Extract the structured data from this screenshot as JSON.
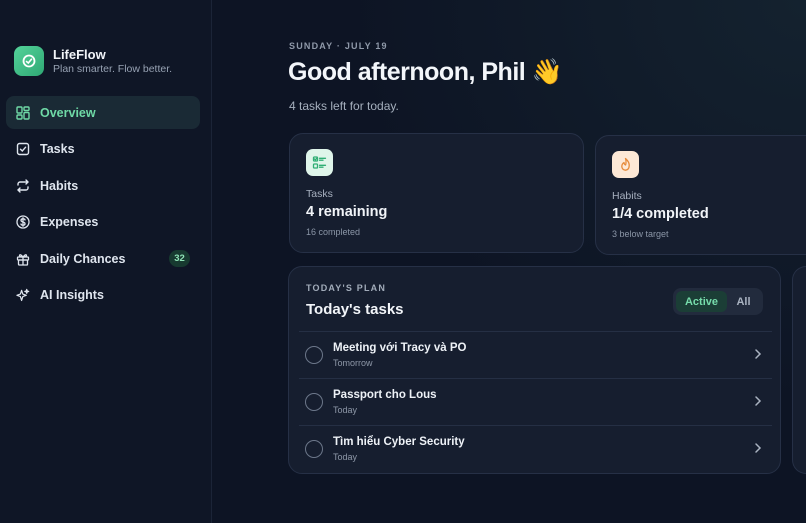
{
  "sidebar": {
    "brand": {
      "name": "LifeFlow",
      "tagline": "Plan smarter. Flow better."
    },
    "items": [
      {
        "label": "Overview",
        "icon": "grid-icon",
        "active": true
      },
      {
        "label": "Tasks",
        "icon": "checkbox-icon"
      },
      {
        "label": "Habits",
        "icon": "repeat-icon"
      },
      {
        "label": "Expenses",
        "icon": "dollar-icon"
      },
      {
        "label": "Daily Chances",
        "icon": "gift-icon",
        "badge": "32"
      },
      {
        "label": "AI Insights",
        "icon": "sparkles-icon"
      }
    ]
  },
  "header": {
    "date": "SUNDAY · JULY 19",
    "greeting": "Good afternoon, Phil 👋",
    "subtitle": "4 tasks left for today."
  },
  "stats": [
    {
      "label": "Tasks",
      "value": "4 remaining",
      "sub": "16 completed",
      "icon": "list-check-icon",
      "icon_bg": "#dff5ea"
    },
    {
      "label": "Habits",
      "value": "1/4 completed",
      "sub": "3 below target",
      "icon": "flame-icon",
      "icon_bg": "#fde8d6"
    }
  ],
  "plan": {
    "eyebrow": "TODAY'S PLAN",
    "title": "Today's tasks",
    "filters": {
      "active": "Active",
      "all": "All"
    },
    "tasks": [
      {
        "title": "Meeting với Tracy và PO",
        "due": "Tomorrow"
      },
      {
        "title": "Passport cho Lous",
        "due": "Today"
      },
      {
        "title": "Tìm hiểu Cyber Security",
        "due": "Today"
      }
    ]
  },
  "colors": {
    "accent": "#6fd9a6",
    "background": "#0d1424",
    "card": "#161e2f"
  }
}
